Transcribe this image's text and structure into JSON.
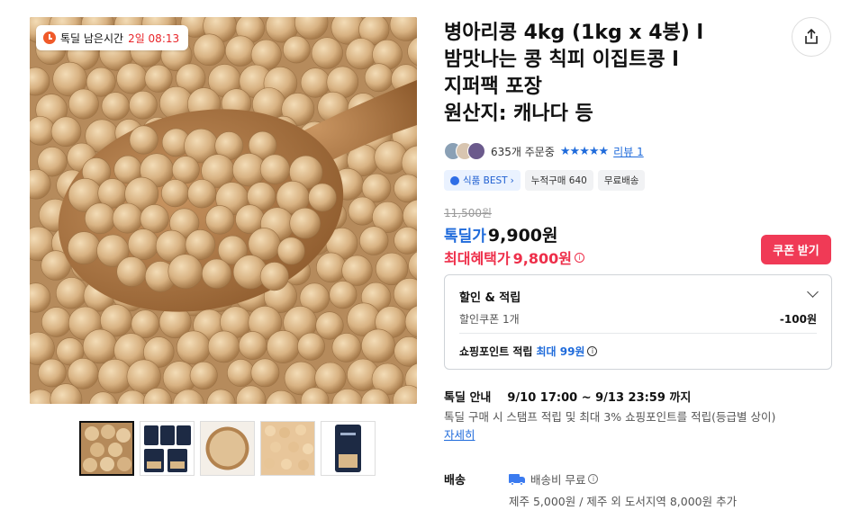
{
  "timer": {
    "label": "톡딜 남은시간",
    "value": "2일 08:13"
  },
  "product": {
    "title_lines": [
      "병아리콩 4kg (1kg x 4봉) l",
      "밤맛나는 콩 칙피 이집트콩 l",
      "지퍼팩 포장",
      "원산지: 캐나다 등"
    ]
  },
  "reviews": {
    "order_count": "635개 주문중",
    "stars": "★★★★★",
    "rating_value": 5,
    "review_link": "리뷰 1"
  },
  "chips": [
    {
      "label": "식품 BEST",
      "type": "best"
    },
    {
      "label": "누적구매 640",
      "type": "plain"
    },
    {
      "label": "무료배송",
      "type": "plain"
    }
  ],
  "price": {
    "original": "11,500원",
    "deal_label": "톡딜가",
    "deal_price": "9,900원",
    "max_label": "최대혜택가",
    "max_price": "9,800원",
    "coupon_button": "쿠폰 받기"
  },
  "discount_box": {
    "heading": "할인 & 적립",
    "coupon_label": "할인쿠폰 1개",
    "coupon_value": "-100원",
    "points_label": "쇼핑포인트 적립",
    "points_value": "최대 99원"
  },
  "deal_info": {
    "label": "톡딜 안내",
    "period": "9/10 17:00 ~ 9/13 23:59 까지",
    "description": "톡딜 구매 시 스탬프 적립 및 최대 3% 쇼핑포인트를 적립(등급별 상이)",
    "detail_link": "자세히"
  },
  "shipping": {
    "label": "배송",
    "fee": "배송비 무료",
    "extra": "제주 5,000원 / 제주 외 도서지역 8,000원 추가"
  },
  "colors": {
    "deal_blue": "#1f6bdb",
    "highlight_red": "#ee2f4a",
    "coupon_button": "#f03a56",
    "timer_red": "#e8252a"
  },
  "icons": {
    "share": "share-icon",
    "timer": "clock-icon",
    "truck": "truck-icon"
  }
}
